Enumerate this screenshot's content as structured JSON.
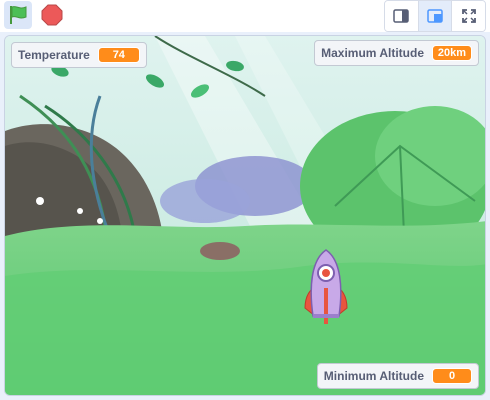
{
  "toolbar": {
    "green_flag_icon": "green-flag-icon",
    "stop_icon": "stop-icon",
    "small_stage_icon": "small-stage-icon",
    "large_stage_icon": "large-stage-icon",
    "fullscreen_icon": "fullscreen-icon"
  },
  "monitors": {
    "temperature": {
      "label": "Temperature",
      "value": "74"
    },
    "max_altitude": {
      "label": "Maximum Altitude",
      "value": "20km"
    },
    "min_altitude": {
      "label": "Minimum Altitude",
      "value": "0"
    }
  },
  "colors": {
    "monitor_value_bg": "#ff8c1a",
    "flag_green": "#4cbf56",
    "stop_red": "#ec5959"
  }
}
